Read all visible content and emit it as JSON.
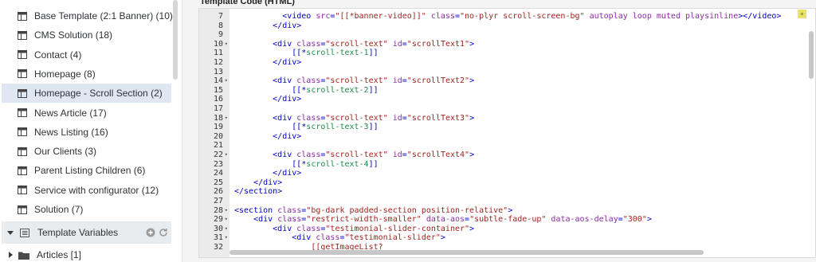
{
  "sidebar": {
    "items": [
      {
        "label": "Base Template (2:1 Banner) (10)",
        "active": false
      },
      {
        "label": "CMS Solution (18)",
        "active": false
      },
      {
        "label": "Contact (4)",
        "active": false
      },
      {
        "label": "Homepage (8)",
        "active": false
      },
      {
        "label": "Homepage - Scroll Section (2)",
        "active": true
      },
      {
        "label": "News Article (17)",
        "active": false
      },
      {
        "label": "News Listing (16)",
        "active": false
      },
      {
        "label": "Our Clients (3)",
        "active": false
      },
      {
        "label": "Parent Listing Children (6)",
        "active": false
      },
      {
        "label": "Service with configurator (12)",
        "active": false
      },
      {
        "label": "Solution (7)",
        "active": false
      }
    ],
    "section_header": {
      "label": "Template Variables"
    },
    "folder": {
      "label": "Articles [1]"
    }
  },
  "main": {
    "title": "Template Code (HTML)",
    "editor": {
      "badge": "+",
      "lines": [
        {
          "num": "7",
          "fold": false,
          "indent": 10,
          "tokens": [
            [
              "tag",
              "<video "
            ],
            [
              "attr",
              "src"
            ],
            [
              "tag",
              "="
            ],
            [
              "str",
              "\"[[*banner-video]]\""
            ],
            [
              "tag",
              " "
            ],
            [
              "attr",
              "class"
            ],
            [
              "tag",
              "="
            ],
            [
              "str",
              "\"no-plyr scroll-screen-bg\""
            ],
            [
              "tag",
              " "
            ],
            [
              "attr",
              "autoplay loop muted playsinline"
            ],
            [
              "tag",
              "></video>"
            ]
          ]
        },
        {
          "num": "8",
          "fold": false,
          "indent": 8,
          "tokens": [
            [
              "tag",
              "</div>"
            ]
          ]
        },
        {
          "num": "9",
          "fold": false,
          "indent": 0,
          "tokens": []
        },
        {
          "num": "10",
          "fold": true,
          "indent": 8,
          "tokens": [
            [
              "tag",
              "<div "
            ],
            [
              "attr",
              "class"
            ],
            [
              "tag",
              "="
            ],
            [
              "str",
              "\"scroll-text\""
            ],
            [
              "tag",
              " "
            ],
            [
              "attr",
              "id"
            ],
            [
              "tag",
              "="
            ],
            [
              "str",
              "\"scrollText1\""
            ],
            [
              "tag",
              ">"
            ]
          ]
        },
        {
          "num": "11",
          "fold": false,
          "indent": 12,
          "tokens": [
            [
              "tag",
              "[[*"
            ],
            [
              "txt",
              "scroll-text-1"
            ],
            [
              "tag",
              "]]"
            ]
          ]
        },
        {
          "num": "12",
          "fold": false,
          "indent": 8,
          "tokens": [
            [
              "tag",
              "</div>"
            ]
          ]
        },
        {
          "num": "13",
          "fold": false,
          "indent": 0,
          "tokens": []
        },
        {
          "num": "14",
          "fold": true,
          "indent": 8,
          "tokens": [
            [
              "tag",
              "<div "
            ],
            [
              "attr",
              "class"
            ],
            [
              "tag",
              "="
            ],
            [
              "str",
              "\"scroll-text\""
            ],
            [
              "tag",
              " "
            ],
            [
              "attr",
              "id"
            ],
            [
              "tag",
              "="
            ],
            [
              "str",
              "\"scrollText2\""
            ],
            [
              "tag",
              ">"
            ]
          ]
        },
        {
          "num": "15",
          "fold": false,
          "indent": 12,
          "tokens": [
            [
              "tag",
              "[[*"
            ],
            [
              "txt",
              "scroll-text-2"
            ],
            [
              "tag",
              "]]"
            ]
          ]
        },
        {
          "num": "16",
          "fold": false,
          "indent": 8,
          "tokens": [
            [
              "tag",
              "</div>"
            ]
          ]
        },
        {
          "num": "17",
          "fold": false,
          "indent": 0,
          "tokens": []
        },
        {
          "num": "18",
          "fold": true,
          "indent": 8,
          "tokens": [
            [
              "tag",
              "<div "
            ],
            [
              "attr",
              "class"
            ],
            [
              "tag",
              "="
            ],
            [
              "str",
              "\"scroll-text\""
            ],
            [
              "tag",
              " "
            ],
            [
              "attr",
              "id"
            ],
            [
              "tag",
              "="
            ],
            [
              "str",
              "\"scrollText3\""
            ],
            [
              "tag",
              ">"
            ]
          ]
        },
        {
          "num": "19",
          "fold": false,
          "indent": 12,
          "tokens": [
            [
              "tag",
              "[[*"
            ],
            [
              "txt",
              "scroll-text-3"
            ],
            [
              "tag",
              "]]"
            ]
          ]
        },
        {
          "num": "20",
          "fold": false,
          "indent": 8,
          "tokens": [
            [
              "tag",
              "</div>"
            ]
          ]
        },
        {
          "num": "21",
          "fold": false,
          "indent": 0,
          "tokens": []
        },
        {
          "num": "22",
          "fold": true,
          "indent": 8,
          "tokens": [
            [
              "tag",
              "<div "
            ],
            [
              "attr",
              "class"
            ],
            [
              "tag",
              "="
            ],
            [
              "str",
              "\"scroll-text\""
            ],
            [
              "tag",
              " "
            ],
            [
              "attr",
              "id"
            ],
            [
              "tag",
              "="
            ],
            [
              "str",
              "\"scrollText4\""
            ],
            [
              "tag",
              ">"
            ]
          ]
        },
        {
          "num": "23",
          "fold": false,
          "indent": 12,
          "tokens": [
            [
              "tag",
              "[[*"
            ],
            [
              "txt",
              "scroll-text-4"
            ],
            [
              "tag",
              "]]"
            ]
          ]
        },
        {
          "num": "24",
          "fold": false,
          "indent": 8,
          "tokens": [
            [
              "tag",
              "</div>"
            ]
          ]
        },
        {
          "num": "25",
          "fold": false,
          "indent": 4,
          "tokens": [
            [
              "tag",
              "</div>"
            ]
          ]
        },
        {
          "num": "26",
          "fold": false,
          "indent": 0,
          "tokens": [
            [
              "tag",
              "</section>"
            ]
          ]
        },
        {
          "num": "27",
          "fold": false,
          "indent": 0,
          "tokens": []
        },
        {
          "num": "28",
          "fold": true,
          "indent": 0,
          "tokens": [
            [
              "tag",
              "<section "
            ],
            [
              "attr",
              "class"
            ],
            [
              "tag",
              "="
            ],
            [
              "str",
              "\"bg-dark padded-section position-relative\""
            ],
            [
              "tag",
              ">"
            ]
          ]
        },
        {
          "num": "29",
          "fold": true,
          "indent": 4,
          "tokens": [
            [
              "tag",
              "<div "
            ],
            [
              "attr",
              "class"
            ],
            [
              "tag",
              "="
            ],
            [
              "str",
              "\"restrict-width-smaller\""
            ],
            [
              "tag",
              " "
            ],
            [
              "attr",
              "data-aos"
            ],
            [
              "tag",
              "="
            ],
            [
              "str",
              "\"subtle-fade-up\""
            ],
            [
              "tag",
              " "
            ],
            [
              "attr",
              "data-aos-delay"
            ],
            [
              "tag",
              "="
            ],
            [
              "str",
              "\"300\""
            ],
            [
              "tag",
              ">"
            ]
          ]
        },
        {
          "num": "30",
          "fold": true,
          "indent": 8,
          "tokens": [
            [
              "tag",
              "<div "
            ],
            [
              "attr",
              "class"
            ],
            [
              "tag",
              "="
            ],
            [
              "str",
              "\"testimonial-slider-container\""
            ],
            [
              "tag",
              ">"
            ]
          ]
        },
        {
          "num": "31",
          "fold": true,
          "indent": 12,
          "tokens": [
            [
              "tag",
              "<div "
            ],
            [
              "attr",
              "class"
            ],
            [
              "tag",
              "="
            ],
            [
              "str",
              "\"testimonial-slider\""
            ],
            [
              "tag",
              ">"
            ]
          ]
        },
        {
          "num": "32",
          "fold": false,
          "indent": 16,
          "tokens": [
            [
              "str",
              "[[getImageList?"
            ]
          ]
        }
      ]
    }
  }
}
